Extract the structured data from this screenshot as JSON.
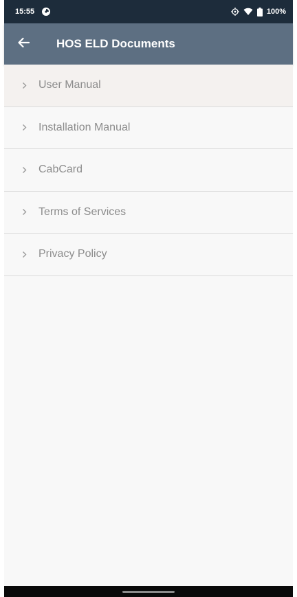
{
  "status_bar": {
    "time": "15:55",
    "battery_percent": "100%",
    "icons": [
      "app-notification-icon",
      "location-icon",
      "wifi-icon",
      "battery-icon"
    ]
  },
  "app_bar": {
    "title": "HOS ELD Documents",
    "back_icon": "back-arrow-icon",
    "background_color": "#5d6f82"
  },
  "documents": {
    "items": [
      {
        "label": "User Manual"
      },
      {
        "label": "Installation Manual"
      },
      {
        "label": "CabCard"
      },
      {
        "label": "Terms of Services"
      },
      {
        "label": "Privacy Policy"
      }
    ],
    "item_icon": "chevron-right-icon"
  },
  "colors": {
    "status_bar": "#1d2c3b",
    "app_bar": "#5d6f82",
    "list_text": "#8c8c8c",
    "divider": "#dcdcdc",
    "background": "#f8f8f8"
  }
}
